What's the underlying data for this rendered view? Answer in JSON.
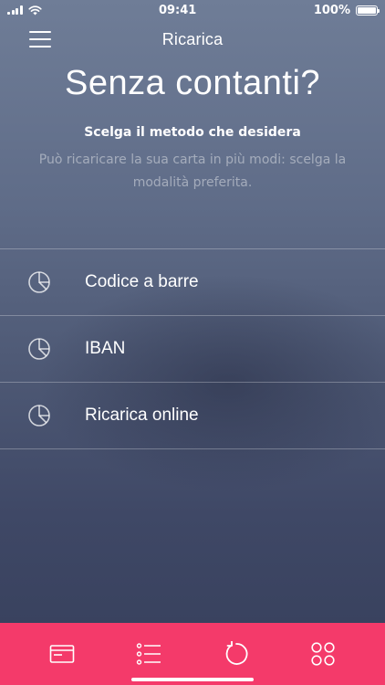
{
  "status_bar": {
    "time": "09:41",
    "battery_text": "100%",
    "battery_level": 1.0
  },
  "nav": {
    "title": "Ricarica",
    "menu_icon": "hamburger-menu-icon"
  },
  "main": {
    "headline": "Senza contanti?",
    "subtitle": "Scelga il metodo che desidera",
    "description": "Può ricaricare la sua carta in più modi: scelga la modalità preferita."
  },
  "methods": [
    {
      "label": "Codice a barre",
      "icon": "pie-chart-icon"
    },
    {
      "label": "IBAN",
      "icon": "pie-chart-icon"
    },
    {
      "label": "Ricarica online",
      "icon": "pie-chart-icon"
    }
  ],
  "tab_bar": {
    "background_color": "#f43a6a",
    "tabs": [
      {
        "icon": "card-icon"
      },
      {
        "icon": "list-icon"
      },
      {
        "icon": "refresh-icon"
      },
      {
        "icon": "grid-icon"
      }
    ]
  }
}
